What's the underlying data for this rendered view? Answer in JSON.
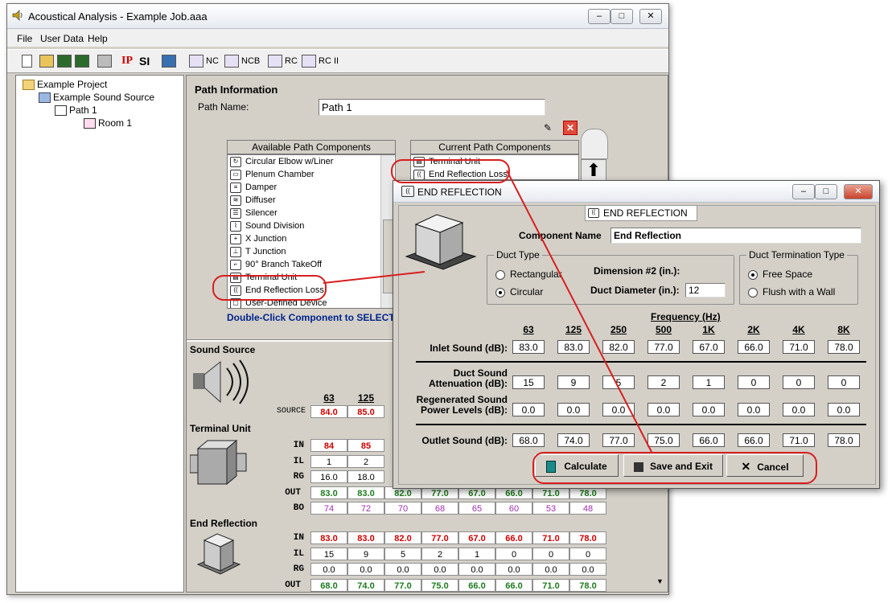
{
  "window": {
    "title": "Acoustical Analysis - Example Job.aaa"
  },
  "menu": [
    "File",
    "User Data",
    "Help"
  ],
  "toolbar": {
    "ip": "IP",
    "si": "SI",
    "nc": "NC",
    "ncb": "NCB",
    "rc": "RC",
    "rc2": "RC II"
  },
  "tree": {
    "project": "Example Project",
    "source": "Example Sound Source",
    "path": "Path 1",
    "room": "Room 1"
  },
  "path_info": {
    "heading": "Path Information",
    "name_label": "Path Name:",
    "name_value": "Path 1",
    "available_header": "Available Path Components",
    "current_header": "Current Path Components",
    "available_items": [
      "Circular Elbow w/Liner",
      "Plenum Chamber",
      "Damper",
      "Diffuser",
      "Silencer",
      "Sound Division",
      "X Junction",
      "T Junction",
      "90° Branch TakeOff",
      "Terminal Unit",
      "End Reflection Loss",
      "User-Defined Device"
    ],
    "current_items": [
      "Terminal Unit",
      "End Reflection Loss"
    ],
    "hint": "Double-Click Component to SELECT"
  },
  "sections": {
    "source": "Sound Source",
    "terminal": "Terminal Unit",
    "end_reflection": "End Reflection"
  },
  "bg_table": {
    "freqs": [
      "63",
      "125"
    ],
    "source_label": "SOURCE",
    "source_values": [
      "84.0",
      "85.0"
    ],
    "terminal_rows": [
      {
        "label": "IN",
        "values": [
          "84",
          "85"
        ]
      },
      {
        "label": "IL",
        "values": [
          "1",
          "2"
        ]
      },
      {
        "label": "RG",
        "values": [
          "16.0",
          "18.0"
        ]
      },
      {
        "label": "OUT",
        "values": [
          "83.0",
          "83.0",
          "82.0",
          "77.0",
          "67.0",
          "66.0",
          "71.0",
          "78.0"
        ]
      },
      {
        "label": "BO",
        "values": [
          "74",
          "72",
          "70",
          "68",
          "65",
          "60",
          "53",
          "48"
        ]
      }
    ],
    "er_rows": [
      {
        "label": "IN",
        "values": [
          "83.0",
          "83.0",
          "82.0",
          "77.0",
          "67.0",
          "66.0",
          "71.0",
          "78.0"
        ]
      },
      {
        "label": "IL",
        "values": [
          "15",
          "9",
          "5",
          "2",
          "1",
          "0",
          "0",
          "0"
        ]
      },
      {
        "label": "RG",
        "values": [
          "0.0",
          "0.0",
          "0.0",
          "0.0",
          "0.0",
          "0.0",
          "0.0",
          "0.0"
        ]
      },
      {
        "label": "OUT",
        "values": [
          "68.0",
          "74.0",
          "77.0",
          "75.0",
          "66.0",
          "66.0",
          "71.0",
          "78.0"
        ]
      }
    ]
  },
  "dialog": {
    "title": "END REFLECTION",
    "header": "END REFLECTION",
    "component_name_label": "Component Name",
    "component_name_value": "End Reflection",
    "duct_type_title": "Duct Type",
    "rect_label": "Rectangular",
    "circ_label": "Circular",
    "dim2_label": "Dimension #2 (in.):",
    "diam_label": "Duct Diameter (in.):",
    "diam_value": "12",
    "term_title": "Duct Termination Type",
    "free_space": "Free Space",
    "flush_wall": "Flush with a Wall",
    "freq_title": "Frequency (Hz)",
    "freqs": [
      "63",
      "125",
      "250",
      "500",
      "1K",
      "2K",
      "4K",
      "8K"
    ],
    "inlet_label": "Inlet Sound (dB):",
    "inlet": [
      "83.0",
      "83.0",
      "82.0",
      "77.0",
      "67.0",
      "66.0",
      "71.0",
      "78.0"
    ],
    "atten_label1": "Duct Sound",
    "atten_label2": "Attenuation (dB):",
    "atten": [
      "15",
      "9",
      "5",
      "2",
      "1",
      "0",
      "0",
      "0"
    ],
    "regen_label1": "Regenerated Sound",
    "regen_label2": "Power Levels (dB):",
    "regen": [
      "0.0",
      "0.0",
      "0.0",
      "0.0",
      "0.0",
      "0.0",
      "0.0",
      "0.0"
    ],
    "outlet_label": "Outlet Sound (dB):",
    "outlet": [
      "68.0",
      "74.0",
      "77.0",
      "75.0",
      "66.0",
      "66.0",
      "71.0",
      "78.0"
    ],
    "btn_calc": "Calculate",
    "btn_save": "Save and Exit",
    "btn_cancel": "Cancel"
  },
  "colors": {
    "red_value": "#d00000",
    "green_value": "#1e7a1e",
    "bo_value": "#9d2fae",
    "annotation": "#d61f1f"
  }
}
